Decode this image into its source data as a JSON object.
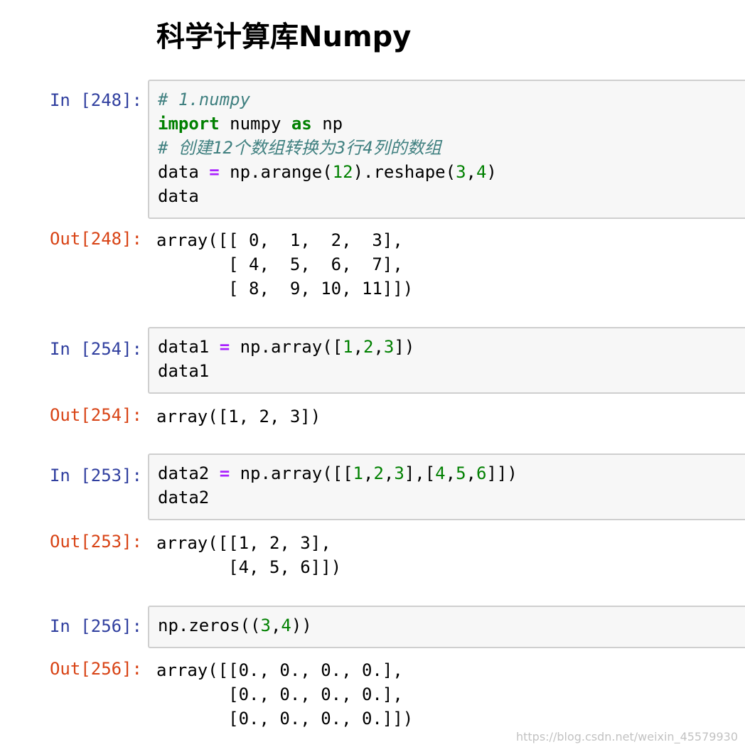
{
  "heading": "科学计算库Numpy",
  "cells": [
    {
      "in_prompt": "In [248]:",
      "code_lines": [
        [
          {
            "t": "# 1.numpy",
            "c": "comment"
          }
        ],
        [
          {
            "t": "import",
            "c": "kw"
          },
          {
            "t": " numpy ",
            "c": ""
          },
          {
            "t": "as",
            "c": "kw"
          },
          {
            "t": " np",
            "c": ""
          }
        ],
        [
          {
            "t": "# 创建12个数组转换为3行4列的数组",
            "c": "comment"
          }
        ],
        [
          {
            "t": "data ",
            "c": ""
          },
          {
            "t": "=",
            "c": "op"
          },
          {
            "t": " np.arange(",
            "c": ""
          },
          {
            "t": "12",
            "c": "num"
          },
          {
            "t": ").reshape(",
            "c": ""
          },
          {
            "t": "3",
            "c": "num"
          },
          {
            "t": ",",
            "c": ""
          },
          {
            "t": "4",
            "c": "num"
          },
          {
            "t": ")",
            "c": ""
          }
        ],
        [
          {
            "t": "data",
            "c": ""
          }
        ]
      ],
      "out_prompt": "Out[248]:",
      "output_lines": [
        "array([[ 0,  1,  2,  3],",
        "       [ 4,  5,  6,  7],",
        "       [ 8,  9, 10, 11]])"
      ]
    },
    {
      "in_prompt": "In [254]:",
      "code_lines": [
        [
          {
            "t": "data1 ",
            "c": ""
          },
          {
            "t": "=",
            "c": "op"
          },
          {
            "t": " np.array([",
            "c": ""
          },
          {
            "t": "1",
            "c": "num"
          },
          {
            "t": ",",
            "c": ""
          },
          {
            "t": "2",
            "c": "num"
          },
          {
            "t": ",",
            "c": ""
          },
          {
            "t": "3",
            "c": "num"
          },
          {
            "t": "])",
            "c": ""
          }
        ],
        [
          {
            "t": "data1",
            "c": ""
          }
        ]
      ],
      "out_prompt": "Out[254]:",
      "output_lines": [
        "array([1, 2, 3])"
      ]
    },
    {
      "in_prompt": "In [253]:",
      "code_lines": [
        [
          {
            "t": "data2 ",
            "c": ""
          },
          {
            "t": "=",
            "c": "op"
          },
          {
            "t": " np.array([[",
            "c": ""
          },
          {
            "t": "1",
            "c": "num"
          },
          {
            "t": ",",
            "c": ""
          },
          {
            "t": "2",
            "c": "num"
          },
          {
            "t": ",",
            "c": ""
          },
          {
            "t": "3",
            "c": "num"
          },
          {
            "t": "],[",
            "c": ""
          },
          {
            "t": "4",
            "c": "num"
          },
          {
            "t": ",",
            "c": ""
          },
          {
            "t": "5",
            "c": "num"
          },
          {
            "t": ",",
            "c": ""
          },
          {
            "t": "6",
            "c": "num"
          },
          {
            "t": "]])",
            "c": ""
          }
        ],
        [
          {
            "t": "data2",
            "c": ""
          }
        ]
      ],
      "out_prompt": "Out[253]:",
      "output_lines": [
        "array([[1, 2, 3],",
        "       [4, 5, 6]])"
      ]
    },
    {
      "in_prompt": "In [256]:",
      "code_lines": [
        [
          {
            "t": "np.zeros((",
            "c": ""
          },
          {
            "t": "3",
            "c": "num"
          },
          {
            "t": ",",
            "c": ""
          },
          {
            "t": "4",
            "c": "num"
          },
          {
            "t": "))",
            "c": ""
          }
        ]
      ],
      "out_prompt": "Out[256]:",
      "output_lines": [
        "array([[0., 0., 0., 0.],",
        "       [0., 0., 0., 0.],",
        "       [0., 0., 0., 0.]])"
      ]
    }
  ],
  "watermark": "https://blog.csdn.net/weixin_45579930"
}
